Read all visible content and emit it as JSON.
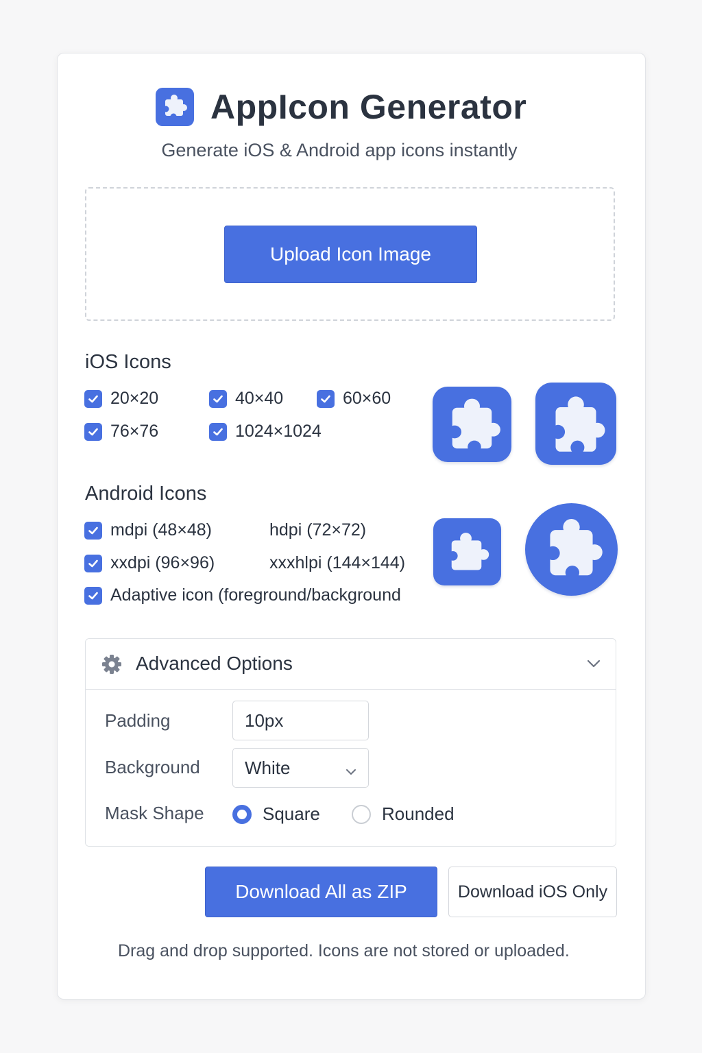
{
  "header": {
    "title": "AppIcon Generator",
    "subtitle": "Generate iOS & Android app icons instantly",
    "logo_icon": "puzzle-piece-icon"
  },
  "upload": {
    "button_label": "Upload Icon Image"
  },
  "ios": {
    "title": "iOS Icons",
    "sizes": [
      {
        "label": "20×20",
        "checked": true
      },
      {
        "label": "40×40",
        "checked": true
      },
      {
        "label": "60×60",
        "checked": true
      },
      {
        "label": "76×76",
        "checked": true
      },
      {
        "label": "1024×1024",
        "checked": true
      }
    ]
  },
  "android": {
    "title": "Android Icons",
    "options": [
      {
        "label": "mdpi (48×48)",
        "checked": true
      },
      {
        "label": "hdpi (72×72)",
        "checked": false
      },
      {
        "label": "xxdpi (96×96)",
        "checked": true
      },
      {
        "label": "xxxhlpi (144×144)",
        "checked": false
      },
      {
        "label": "Adaptive icon (foreground/background",
        "checked": true
      }
    ]
  },
  "advanced": {
    "title": "Advanced Options",
    "padding_label": "Padding",
    "padding_value": "10px",
    "background_label": "Background",
    "background_value": "White",
    "mask_label": "Mask Shape",
    "mask_options": [
      {
        "label": "Square",
        "selected": true
      },
      {
        "label": "Rounded",
        "selected": false
      }
    ]
  },
  "actions": {
    "download_zip": "Download All as ZIP",
    "download_ios": "Download iOS Only"
  },
  "footer": {
    "note": "Drag and drop supported. Icons are not stored or uploaded."
  },
  "colors": {
    "accent": "#4870e0",
    "text": "#2b3340",
    "muted": "#4a5260",
    "border": "#dfe2e6"
  }
}
